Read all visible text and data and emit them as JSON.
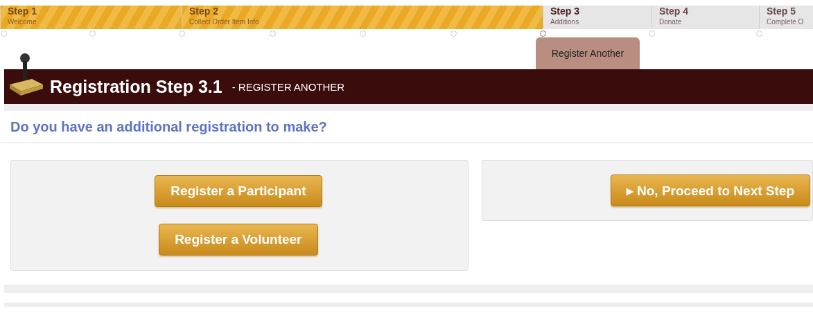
{
  "steps": [
    {
      "title": "Step 1",
      "subtitle": "Welcome",
      "completed": true,
      "selected": false
    },
    {
      "title": "Step 2",
      "subtitle": "Collect Order Item Info",
      "completed": true,
      "selected": false
    },
    {
      "title": "Step 3",
      "subtitle": "Additions",
      "completed": false,
      "selected": true
    },
    {
      "title": "Step 4",
      "subtitle": "Donate",
      "completed": false,
      "selected": false
    },
    {
      "title": "Step 5",
      "subtitle": "Complete O",
      "completed": false,
      "selected": false
    }
  ],
  "substep_tab": {
    "label": "Register Another"
  },
  "header": {
    "title": "Registration Step 3.1",
    "subtitle": "- REGISTER ANOTHER"
  },
  "question": "Do you have an additional registration to make?",
  "left_buttons": [
    "Register a Participant",
    "Register a Volunteer"
  ],
  "next_button": {
    "label": "No, Proceed to Next Step",
    "arrow": "▸"
  }
}
